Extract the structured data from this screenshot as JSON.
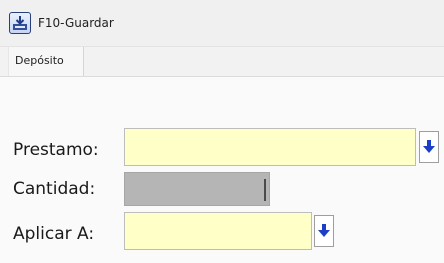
{
  "toolbar": {
    "save_label": "F10-Guardar",
    "save_icon": "save-icon"
  },
  "tabs": [
    {
      "label": "Depósito",
      "active": true
    }
  ],
  "form": {
    "prestamo_label": "Prestamo:",
    "prestamo_value": "",
    "cantidad_label": "Cantidad:",
    "cantidad_value": "",
    "aplicar_label": "Aplicar A:",
    "aplicar_value": ""
  },
  "colors": {
    "field_bg": "#ffffc8",
    "disabled_bg": "#b5b5b5",
    "arrow_blue": "#1d3fc7"
  }
}
